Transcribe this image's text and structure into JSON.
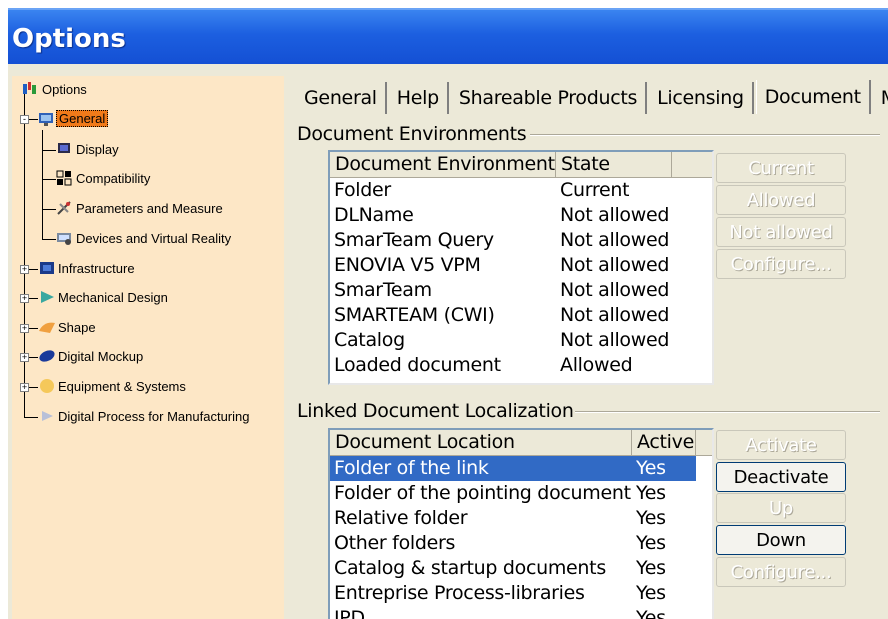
{
  "window": {
    "title": "Options"
  },
  "tree": {
    "root": "Options",
    "items": [
      {
        "label": "General",
        "icon": "general-icon",
        "selected": true
      },
      {
        "label": "Display",
        "icon": "display-icon"
      },
      {
        "label": "Compatibility",
        "icon": "compatibility-icon"
      },
      {
        "label": "Parameters and Measure",
        "icon": "parameters-icon"
      },
      {
        "label": "Devices and Virtual Reality",
        "icon": "devices-icon"
      },
      {
        "label": "Infrastructure",
        "icon": "infrastructure-icon"
      },
      {
        "label": "Mechanical Design",
        "icon": "mechanical-design-icon"
      },
      {
        "label": "Shape",
        "icon": "shape-icon"
      },
      {
        "label": "Digital Mockup",
        "icon": "digital-mockup-icon"
      },
      {
        "label": "Equipment & Systems",
        "icon": "equipment-icon"
      },
      {
        "label": "Digital Process for Manufacturing",
        "icon": "manufacturing-icon"
      }
    ]
  },
  "tabs": [
    "General",
    "Help",
    "Shareable Products",
    "Licensing",
    "Document",
    "M"
  ],
  "active_tab": "Document",
  "doc_env": {
    "group_label": "Document Environments",
    "columns": [
      "Document Environment",
      "State"
    ],
    "rows": [
      [
        "Folder",
        "Current"
      ],
      [
        "DLName",
        "Not allowed"
      ],
      [
        "SmarTeam Query",
        "Not allowed"
      ],
      [
        "ENOVIA V5 VPM",
        "Not allowed"
      ],
      [
        "SmarTeam",
        "Not allowed"
      ],
      [
        "SMARTEAM (CWI)",
        "Not allowed"
      ],
      [
        "Catalog",
        "Not allowed"
      ],
      [
        "Loaded document",
        "Allowed"
      ]
    ],
    "buttons": [
      "Current",
      "Allowed",
      "Not allowed",
      "Configure..."
    ]
  },
  "linked": {
    "group_label": "Linked Document Localization",
    "columns": [
      "Document Location",
      "Active"
    ],
    "rows": [
      [
        "Folder of the link",
        "Yes"
      ],
      [
        "Folder of the pointing document",
        "Yes"
      ],
      [
        "Relative folder",
        "Yes"
      ],
      [
        "Other folders",
        "Yes"
      ],
      [
        "Catalog & startup documents",
        "Yes"
      ],
      [
        "Entreprise Process-libraries",
        "Yes"
      ],
      [
        "IPD",
        "Yes"
      ]
    ],
    "selected_row": 0,
    "buttons": [
      "Activate",
      "Deactivate",
      "Up",
      "Down",
      "Configure..."
    ]
  },
  "colors": {
    "titlebar": "#1c5fe0",
    "tree_bg": "#fde7c6",
    "selection": "#316ac5",
    "tree_selected": "#f07a1a"
  }
}
